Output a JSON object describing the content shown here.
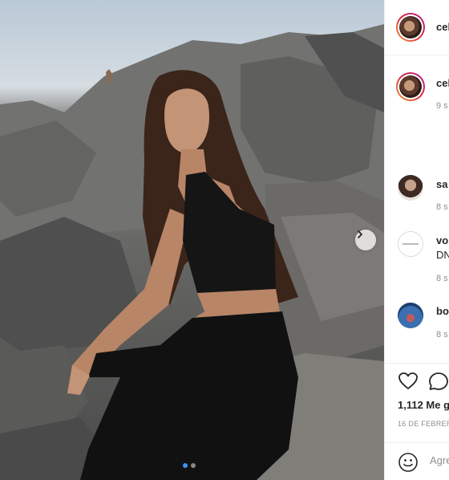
{
  "post": {
    "author": {
      "username": "cel"
    },
    "caption_time": "9 s",
    "comments": [
      {
        "username": "sa",
        "text": "",
        "time": "8 s"
      },
      {
        "username": "vo",
        "text": "DN",
        "time": "8 s"
      },
      {
        "username": "bo",
        "text": "",
        "time": "8 s"
      }
    ],
    "likes": "1,112 Me g",
    "date": "16 DE FEBRERO",
    "comment_placeholder": "Agre",
    "carousel": {
      "current": 1,
      "total": 2
    }
  },
  "colors": {
    "accent": "#3897f0",
    "story_ring_start": "#f09433",
    "story_ring_end": "#bc1888",
    "secondary_text": "#8e8e8e",
    "primary_text": "#262626"
  },
  "icons": {
    "next": "chevron-right-icon",
    "like": "heart-icon",
    "comment": "comment-bubble-icon",
    "emoji": "smiley-icon"
  }
}
